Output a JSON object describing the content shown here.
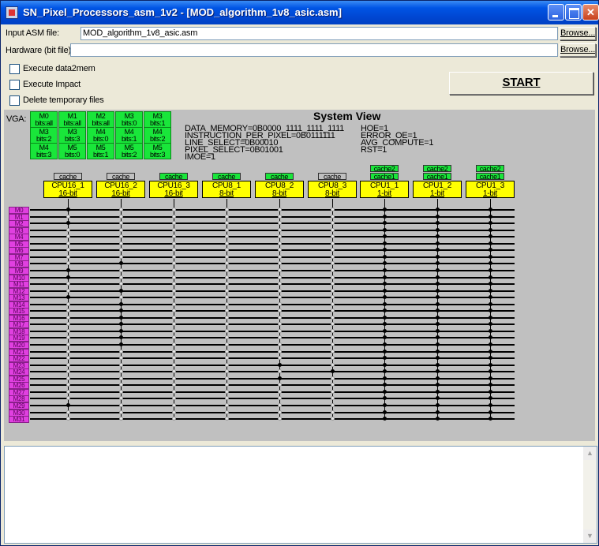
{
  "window": {
    "title": "SN_Pixel_Processors_asm_1v2 - [MOD_algorithm_1v8_asic.asm]"
  },
  "form": {
    "asm_label": "Input ASM file:",
    "asm_value": "MOD_algorithm_1v8_asic.asm",
    "asm_browse": "Browse...",
    "hw_label": "Hardware (bit file):",
    "hw_value": "",
    "hw_browse": "Browse..."
  },
  "options": [
    {
      "label": "Execute data2mem",
      "checked": false
    },
    {
      "label": "Execute Impact",
      "checked": false
    },
    {
      "label": "Delete temporary files",
      "checked": false
    }
  ],
  "start_label": "START",
  "system_view": {
    "title": "System View",
    "vga_label": "VGA:",
    "vga_cells": [
      [
        "M0",
        "bits:all"
      ],
      [
        "M1",
        "bits:all"
      ],
      [
        "M2",
        "bits:all"
      ],
      [
        "M3",
        "bits:0"
      ],
      [
        "M3",
        "bits:1"
      ],
      [
        "M3",
        "bits:2"
      ],
      [
        "M3",
        "bits:3"
      ],
      [
        "M4",
        "bits:0"
      ],
      [
        "M4",
        "bits:1"
      ],
      [
        "M4",
        "bits:2"
      ],
      [
        "M4",
        "bits:3"
      ],
      [
        "M5",
        "bits:0"
      ],
      [
        "M5",
        "bits:1"
      ],
      [
        "M5",
        "bits:2"
      ],
      [
        "M5",
        "bits:3"
      ]
    ],
    "status_left": [
      "DATA_MEMORY=0B0000_1111_1111_1111",
      "INSTRUCTION_PER_PIXEL=0B0111111",
      "LINE_SELECT=0B00010",
      "PIXEL_SELECT=0B01001",
      "IMOE=1"
    ],
    "status_right": [
      "HOE=1",
      "ERROR_OE=1",
      "AVG_COMPUTE=1",
      "RST=1"
    ],
    "cpus": [
      {
        "name": "CPU16_1",
        "bits": "16-bit",
        "caches": [
          {
            "label": "cache",
            "active": false
          }
        ]
      },
      {
        "name": "CPU16_2",
        "bits": "16-bit",
        "caches": [
          {
            "label": "cache",
            "active": false
          }
        ]
      },
      {
        "name": "CPU16_3",
        "bits": "16-bit",
        "caches": [
          {
            "label": "cache",
            "active": true
          }
        ]
      },
      {
        "name": "CPU8_1",
        "bits": "8-bit",
        "caches": [
          {
            "label": "cache",
            "active": true
          }
        ]
      },
      {
        "name": "CPU8_2",
        "bits": "8-bit",
        "caches": [
          {
            "label": "cache",
            "active": true
          }
        ]
      },
      {
        "name": "CPU8_3",
        "bits": "8-bit",
        "caches": [
          {
            "label": "cache",
            "active": false
          }
        ]
      },
      {
        "name": "CPU1_1",
        "bits": "1-bit",
        "caches": [
          {
            "label": "cache2",
            "active": true
          },
          {
            "label": "cache1",
            "active": true
          }
        ]
      },
      {
        "name": "CPU1_2",
        "bits": "1-bit",
        "caches": [
          {
            "label": "cache2",
            "active": true
          },
          {
            "label": "cache1",
            "active": true
          }
        ]
      },
      {
        "name": "CPU1_3",
        "bits": "1-bit",
        "caches": [
          {
            "label": "cache2",
            "active": true
          },
          {
            "label": "cache1",
            "active": true
          }
        ]
      }
    ],
    "memories": [
      "M0",
      "M1",
      "M2",
      "M3",
      "M4",
      "M5",
      "M6",
      "M7",
      "M8",
      "M9",
      "M10",
      "M11",
      "M12",
      "M13",
      "M14",
      "M15",
      "M16",
      "M17",
      "M18",
      "M19",
      "M20",
      "M21",
      "M22",
      "M23",
      "M24",
      "M25",
      "M26",
      "M27",
      "M28",
      "M29",
      "M30",
      "M31"
    ],
    "connections": [
      [
        1,
        0,
        0,
        0,
        0,
        0,
        1,
        1,
        1
      ],
      [
        0,
        0,
        0,
        0,
        0,
        0,
        1,
        1,
        1
      ],
      [
        1,
        0,
        0,
        0,
        0,
        0,
        1,
        1,
        1
      ],
      [
        0,
        0,
        0,
        0,
        0,
        0,
        1,
        1,
        1
      ],
      [
        0,
        0,
        0,
        0,
        0,
        0,
        1,
        1,
        1
      ],
      [
        0,
        0,
        0,
        0,
        0,
        0,
        1,
        1,
        1
      ],
      [
        0,
        0,
        0,
        0,
        0,
        0,
        1,
        1,
        1
      ],
      [
        0,
        0,
        0,
        0,
        0,
        0,
        1,
        1,
        1
      ],
      [
        0,
        1,
        0,
        0,
        0,
        0,
        1,
        1,
        1
      ],
      [
        1,
        0,
        0,
        0,
        0,
        0,
        1,
        1,
        1
      ],
      [
        1,
        0,
        0,
        0,
        0,
        0,
        1,
        1,
        1
      ],
      [
        0,
        0,
        0,
        0,
        0,
        0,
        1,
        1,
        1
      ],
      [
        0,
        1,
        0,
        0,
        0,
        0,
        1,
        1,
        1
      ],
      [
        1,
        0,
        0,
        0,
        0,
        0,
        1,
        1,
        1
      ],
      [
        0,
        1,
        0,
        0,
        0,
        0,
        1,
        1,
        1
      ],
      [
        0,
        1,
        0,
        0,
        0,
        0,
        1,
        1,
        1
      ],
      [
        0,
        1,
        0,
        0,
        0,
        0,
        1,
        1,
        1
      ],
      [
        0,
        1,
        0,
        0,
        0,
        0,
        1,
        1,
        1
      ],
      [
        0,
        1,
        0,
        0,
        0,
        0,
        1,
        1,
        1
      ],
      [
        0,
        1,
        0,
        0,
        0,
        0,
        1,
        1,
        1
      ],
      [
        0,
        1,
        0,
        0,
        0,
        0,
        1,
        1,
        1
      ],
      [
        0,
        0,
        0,
        0,
        0,
        0,
        1,
        1,
        1
      ],
      [
        0,
        0,
        0,
        0,
        0,
        0,
        1,
        1,
        1
      ],
      [
        0,
        0,
        0,
        0,
        1,
        0,
        1,
        1,
        1
      ],
      [
        0,
        0,
        0,
        0,
        0,
        1,
        1,
        1,
        1
      ],
      [
        0,
        0,
        0,
        0,
        1,
        0,
        1,
        1,
        1
      ],
      [
        0,
        0,
        0,
        0,
        0,
        0,
        1,
        1,
        1
      ],
      [
        0,
        0,
        0,
        0,
        0,
        0,
        1,
        1,
        1
      ],
      [
        0,
        0,
        0,
        0,
        0,
        0,
        1,
        1,
        1
      ],
      [
        1,
        0,
        0,
        0,
        0,
        0,
        1,
        1,
        1
      ],
      [
        0,
        0,
        0,
        0,
        0,
        0,
        1,
        1,
        1
      ],
      [
        0,
        0,
        0,
        0,
        0,
        0,
        1,
        1,
        1
      ]
    ]
  },
  "log": {
    "text": ""
  },
  "colors": {
    "cpu": "#ffff00",
    "cache_active": "#19e63a",
    "memory": "#e040e0",
    "panel": "#c0c0c0"
  }
}
